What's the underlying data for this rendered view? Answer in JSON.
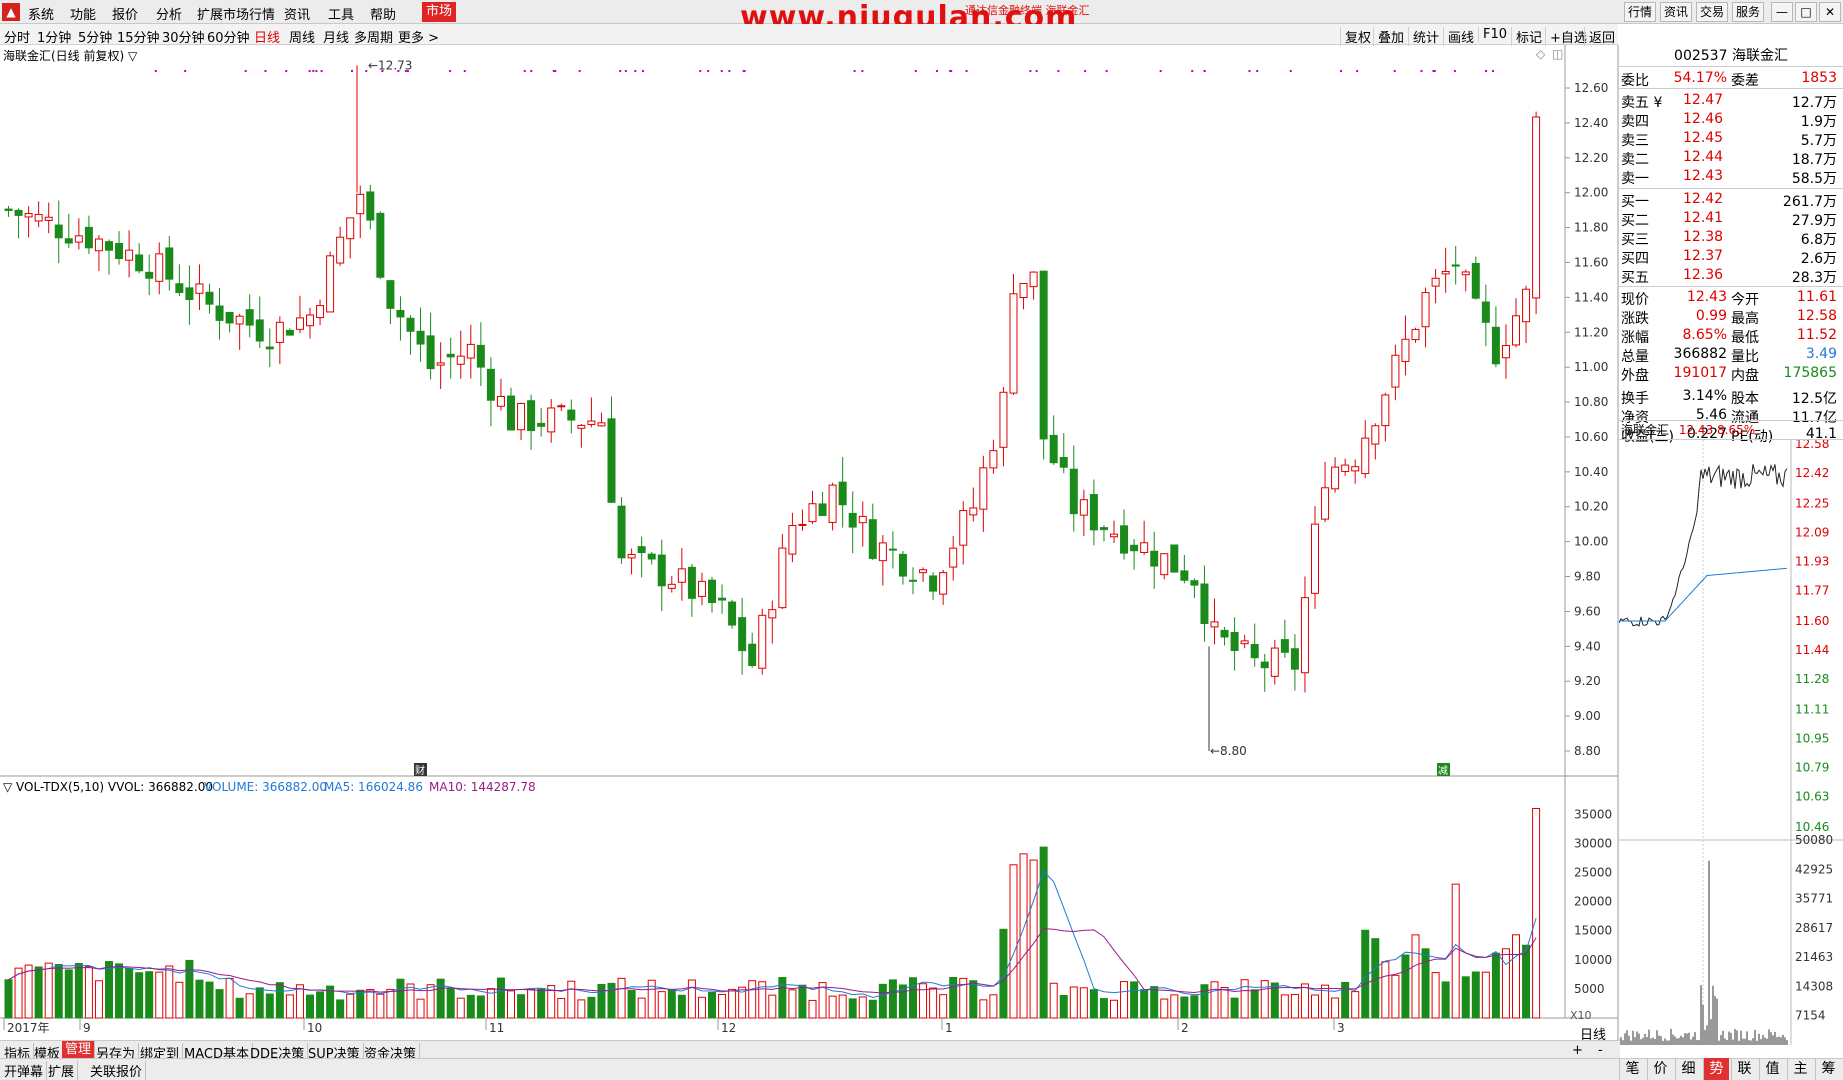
{
  "menubar": {
    "items": [
      "系统",
      "功能",
      "报价",
      "分析",
      "扩展市场行情",
      "资讯",
      "工具",
      "帮助"
    ],
    "market": "市场",
    "watermark": "www.niugulan.com",
    "watermark_sub": "通达信金融终端  海联金汇",
    "right_buttons": [
      "行情",
      "资讯",
      "交易",
      "服务"
    ],
    "window_controls": [
      "—",
      "□",
      "✕"
    ]
  },
  "periods": {
    "items": [
      "分时",
      "1分钟",
      "5分钟",
      "15分钟",
      "30分钟",
      "60分钟",
      "日线",
      "周线",
      "月线",
      "多周期",
      "更多 >"
    ],
    "selected": "日线"
  },
  "tools": [
    "复权",
    "叠加",
    "统计",
    "画线",
    "F10",
    "标记",
    "+自选",
    "返回"
  ],
  "chart": {
    "title": "海联金汇(日线 前复权) ▽",
    "high_label": "12.73",
    "low_label": "8.80",
    "price_ticks": [
      "12.60",
      "12.40",
      "12.20",
      "12.00",
      "11.80",
      "11.60",
      "11.40",
      "11.20",
      "11.00",
      "10.80",
      "10.60",
      "10.40",
      "10.20",
      "10.00",
      "9.80",
      "9.60",
      "9.40",
      "9.20",
      "9.00",
      "8.80"
    ],
    "marker_cai": "财",
    "marker_jian": "减"
  },
  "volume": {
    "label": "▽ VOL-TDX(5,10)  VVOL: 366882.00",
    "vol": "VOLUME: 366882.00",
    "ma5": "MA5: 166024.86",
    "ma10": "MA10: 144287.78",
    "ticks": [
      "35000",
      "30000",
      "25000",
      "20000",
      "15000",
      "10000",
      "5000"
    ],
    "unit": "X10",
    "date_labels": [
      "2017年",
      "9",
      "10",
      "11",
      "12",
      "1",
      "2",
      "3"
    ]
  },
  "quote": {
    "code": "002537",
    "name": "海联金汇",
    "weibi_label": "委比",
    "weibi": "54.17%",
    "weicha_label": "委差",
    "weicha": "1853",
    "sell": [
      {
        "label": "卖五 ¥",
        "price": "12.47",
        "vol": "12.7万"
      },
      {
        "label": "卖四",
        "price": "12.46",
        "vol": "1.9万"
      },
      {
        "label": "卖三",
        "price": "12.45",
        "vol": "5.7万"
      },
      {
        "label": "卖二",
        "price": "12.44",
        "vol": "18.7万"
      },
      {
        "label": "卖一",
        "price": "12.43",
        "vol": "58.5万"
      }
    ],
    "buy": [
      {
        "label": "买一",
        "price": "12.42",
        "vol": "261.7万"
      },
      {
        "label": "买二",
        "price": "12.41",
        "vol": "27.9万"
      },
      {
        "label": "买三",
        "price": "12.38",
        "vol": "6.8万"
      },
      {
        "label": "买四",
        "price": "12.37",
        "vol": "2.6万"
      },
      {
        "label": "买五",
        "price": "12.36",
        "vol": "28.3万"
      }
    ],
    "stats": [
      [
        "现价",
        "12.43",
        "今开",
        "11.61"
      ],
      [
        "涨跌",
        "0.99",
        "最高",
        "12.58"
      ],
      [
        "涨幅",
        "8.65%",
        "最低",
        "11.52"
      ],
      [
        "总量",
        "366882",
        "量比",
        "3.49"
      ],
      [
        "外盘",
        "191017",
        "内盘",
        "175865"
      ],
      [
        "换手",
        "3.14%",
        "股本",
        "12.5亿"
      ],
      [
        "净资",
        "5.46",
        "流通",
        "11.7亿"
      ],
      [
        "收益(三)",
        "0.227",
        "PE(动)",
        "41.1"
      ]
    ]
  },
  "mini": {
    "title": "海联金汇",
    "price": "12.43",
    "pct": "8.65%",
    "ticks": [
      "12.58",
      "12.42",
      "12.25",
      "12.09",
      "11.93",
      "11.77",
      "11.60",
      "11.44",
      "11.28",
      "11.11",
      "10.95",
      "10.79",
      "10.63",
      "10.46"
    ],
    "vol_ticks": [
      "50080",
      "42925",
      "35771",
      "28617",
      "21463",
      "14308",
      "7154"
    ]
  },
  "bottom": {
    "tabs1": [
      "指标",
      "模板",
      "管理",
      "另存为",
      "绑定到",
      "MACD基本",
      "DDE决策",
      "SUP决策",
      "资金决策"
    ],
    "tabs1_sel": "管理",
    "tabs2": [
      "开弹幕",
      "扩展",
      "关联报价"
    ],
    "day_label": "日线",
    "zoom": [
      "+",
      "-"
    ],
    "right_tabs": [
      "笔",
      "价",
      "细",
      "势",
      "联",
      "值",
      "主",
      "筹"
    ],
    "right_sel": "势"
  },
  "colors": {
    "up": "#e00000",
    "down": "#1a8a1a",
    "ma5": "#1e7ad8",
    "ma10": "#9a1a8a"
  }
}
